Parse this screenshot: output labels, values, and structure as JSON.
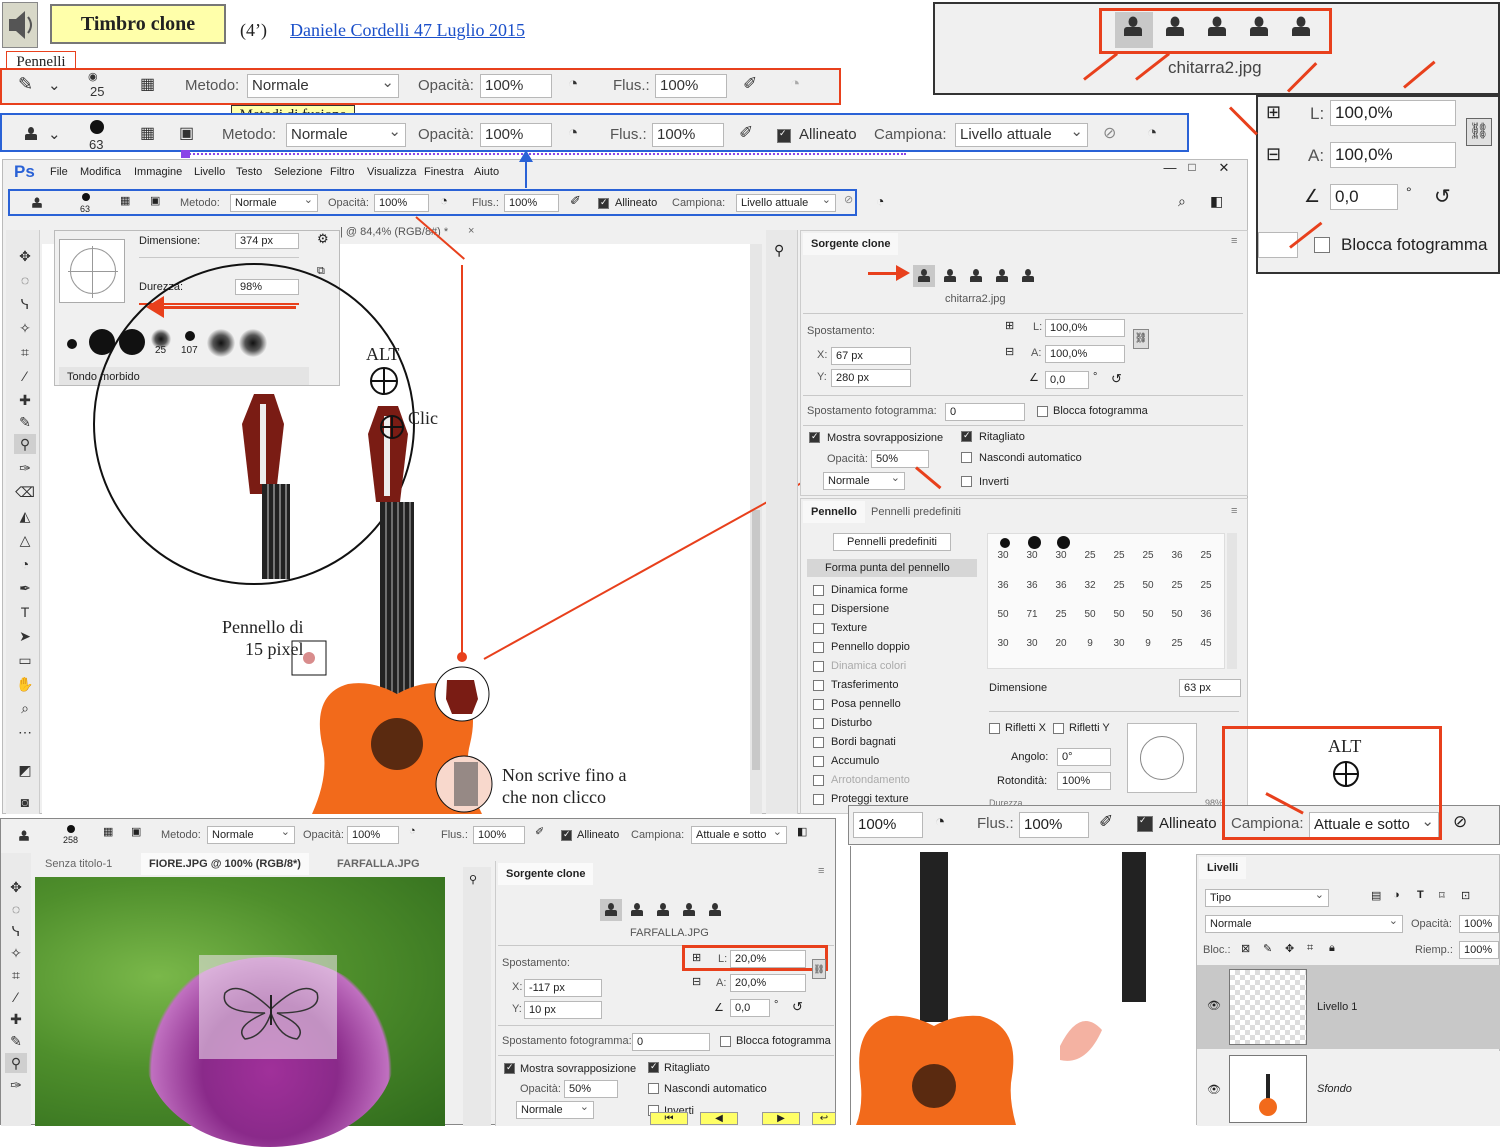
{
  "header": {
    "title": "Timbro clone",
    "duration": "(4’)",
    "author_link": "Daniele Cordelli 47 Luglio 2015"
  },
  "callouts": {
    "pennelli": "Pennelli",
    "metodi_fusione": "Metodi di fusione",
    "alt": "ALT",
    "clic": "Clic",
    "pennello_15": "Pennello di\n15 pixel",
    "non_scrive": "Non scrive fino a\nche non clicco",
    "alt2": "ALT"
  },
  "toolbar1": {
    "brush_size": "25",
    "metodo_label": "Metodo:",
    "metodo_value": "Normale",
    "opacita_label": "Opacità:",
    "opacita_value": "100%",
    "flus_label": "Flus.:",
    "flus_value": "100%"
  },
  "toolbar2": {
    "brush_size": "63",
    "metodo_label": "Metodo:",
    "metodo_value": "Normale",
    "opacita_label": "Opacità:",
    "opacita_value": "100%",
    "flus_label": "Flus.:",
    "flus_value": "100%",
    "allineato": "Allineato",
    "campiona_label": "Campiona:",
    "campiona_value": "Livello attuale"
  },
  "zoom_panel": {
    "filename": "chitarra2.jpg",
    "l_label": "L:",
    "l_value": "100,0%",
    "a_label": "A:",
    "a_value": "100,0%",
    "angle_value": "0,0",
    "deg": "°",
    "blocca": "Blocca fotogramma"
  },
  "ps": {
    "logo": "Ps",
    "menu": [
      "File",
      "Modifica",
      "Immagine",
      "Livello",
      "Testo",
      "Selezione",
      "Filtro",
      "Visualizza",
      "Finestra",
      "Aiuto"
    ],
    "opt_size": "63",
    "opt_metodo_label": "Metodo:",
    "opt_metodo": "Normale",
    "opt_opacita_label": "Opacità:",
    "opt_opacita": "100%",
    "opt_flus_label": "Flus.:",
    "opt_flus": "100%",
    "opt_allineato": "Allineato",
    "opt_campiona_label": "Campiona:",
    "opt_campiona": "Livello attuale",
    "doc_tab": "| @ 84,4% (RGB/8#) *",
    "brush_popup": {
      "dimensione_label": "Dimensione:",
      "dimensione": "374 px",
      "durezza_label": "Durezza:",
      "durezza": "98%",
      "presets": [
        "25",
        "107"
      ],
      "preset_name": "Tondo morbido"
    }
  },
  "clone_source": {
    "title": "Sorgente clone",
    "file": "chitarra2.jpg",
    "spostamento": "Spostamento:",
    "x_label": "X:",
    "x": "67 px",
    "y_label": "Y:",
    "y": "280 px",
    "l_label": "L:",
    "l": "100,0%",
    "a_label": "A:",
    "a": "100,0%",
    "angle": "0,0",
    "deg": "°",
    "spost_fotogramma": "Spostamento fotogramma:",
    "spost_fotogramma_val": "0",
    "blocca": "Blocca fotogramma",
    "mostra": "Mostra sovrapposizione",
    "ritagliato": "Ritagliato",
    "opacita_label": "Opacità:",
    "opacita": "50%",
    "nascondi": "Nascondi automatico",
    "normale": "Normale",
    "inverti": "Inverti"
  },
  "brush_panel": {
    "tabs": [
      "Pennello",
      "Pennelli predefiniti"
    ],
    "predef_button": "Pennelli predefiniti",
    "items": [
      "Forma punta del pennello",
      "Dinamica forme",
      "Dispersione",
      "Texture",
      "Pennello doppio",
      "Dinamica colori",
      "Trasferimento",
      "Posa pennello",
      "Disturbo",
      "Bordi bagnati",
      "Accumulo",
      "Arrotondamento",
      "Proteggi texture"
    ],
    "grid_numbers": [
      [
        "30",
        "30",
        "30",
        "25",
        "25",
        "25",
        "36",
        "25"
      ],
      [
        "36",
        "36",
        "36",
        "32",
        "25",
        "50",
        "25",
        "25"
      ],
      [
        "50",
        "71",
        "25",
        "50",
        "50",
        "50",
        "50",
        "36"
      ],
      [
        "30",
        "30",
        "20",
        "9",
        "30",
        "9",
        "25",
        "45"
      ]
    ],
    "dimensione_label": "Dimensione",
    "dimensione": "63 px",
    "rifletti_x": "Rifletti X",
    "rifletti_y": "Rifletti Y",
    "angolo_label": "Angolo:",
    "angolo": "0°",
    "rotondita_label": "Rotondità:",
    "rotondita": "100%",
    "durezza_label": "Durezza",
    "durezza": "98%"
  },
  "toolbar3": {
    "opacita_value": "100%",
    "flus_label": "Flus.:",
    "flus_value": "100%",
    "allineato": "Allineato",
    "campiona_label": "Campiona:",
    "campiona_value": "Attuale e sotto"
  },
  "ps2": {
    "size": "258",
    "metodo_label": "Metodo:",
    "metodo": "Normale",
    "opacita_label": "Opacità:",
    "opacita": "100%",
    "flus_label": "Flus.:",
    "flus": "100%",
    "allineato": "Allineato",
    "campiona_label": "Campiona:",
    "campiona": "Attuale e sotto",
    "tabs": [
      "Senza titolo-1",
      "FIORE.JPG @ 100% (RGB/8*)",
      "FARFALLA.JPG"
    ],
    "clone_title": "Sorgente clone",
    "clone_file": "FARFALLA.JPG",
    "spostamento": "Spostamento:",
    "x_label": "X:",
    "x": "-117 px",
    "y_label": "Y:",
    "y": "10 px",
    "l_label": "L:",
    "l": "20,0%",
    "a_label": "A:",
    "a": "20,0%",
    "angle": "0,0",
    "deg": "°",
    "spost_fotogramma": "Spostamento fotogramma:",
    "spost_fotogramma_val": "0",
    "blocca": "Blocca fotogramma",
    "mostra": "Mostra sovrapposizione",
    "ritagliato": "Ritagliato",
    "opacita2_label": "Opacità:",
    "opacita2": "50%",
    "nascondi": "Nascondi automatico",
    "normale": "Normale",
    "inverti": "Inverti"
  },
  "layers": {
    "title": "Livelli",
    "tipo": "Tipo",
    "blend": "Normale",
    "opacita_label": "Opacità:",
    "opacita": "100%",
    "bloc_label": "Bloc.:",
    "riemp_label": "Riemp.:",
    "riemp": "100%",
    "items": [
      "Livello 1",
      "Sfondo"
    ]
  },
  "colors": {
    "accent_red": "#e8401c",
    "accent_blue": "#2a62d6",
    "link_blue": "#1a4fc9",
    "guitar_orange": "#f26a1b"
  }
}
